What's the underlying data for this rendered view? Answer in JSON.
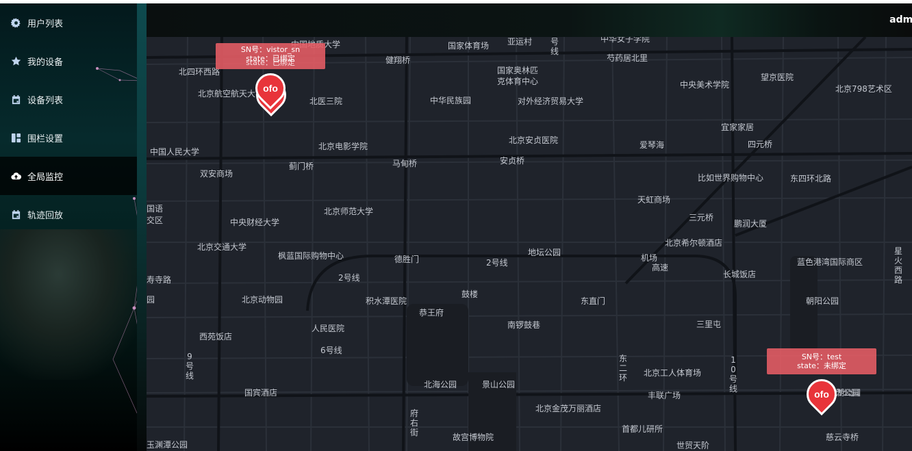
{
  "header": {
    "username": "admi"
  },
  "sidebar": {
    "items": [
      {
        "label": "用户列表",
        "icon": "gear-icon"
      },
      {
        "label": "我的设备",
        "icon": "star-icon"
      },
      {
        "label": "设备列表",
        "icon": "calendar-icon"
      },
      {
        "label": "围栏设置",
        "icon": "layout-icon"
      },
      {
        "label": "全局监控",
        "icon": "cloud-upload-icon",
        "active": true
      },
      {
        "label": "轨迹回放",
        "icon": "calendar-icon"
      }
    ]
  },
  "map": {
    "labels": [
      "中国地质大学",
      "国家体育场",
      "亚运村",
      "号",
      "线",
      "中华女子学院",
      "北四环西路",
      "健翔桥",
      "芍药居北里",
      "北京航空航天大学",
      "国家奥林匹",
      "克体育中心",
      "中央美术学院",
      "望京医院",
      "北京798艺术区",
      "北医三院",
      "中华民族园",
      "对外经济贸易大学",
      "宜家家居",
      "四元桥",
      "中国人民大学",
      "北京电影学院",
      "北京安贞医院",
      "爱琴海",
      "双安商场",
      "蓟门桥",
      "马甸桥",
      "安贞桥",
      "比如世界购物中心",
      "东四环北路",
      "天虹商场",
      "三元桥",
      "鹏润大厦",
      "国语",
      "交区",
      "中央财经大学",
      "北京师范大学",
      "北京希尔顿酒店",
      "北京交通大学",
      "枫蓝国际购物中心",
      "德胜门",
      "2号线",
      "地坛公园",
      "机场",
      "高速",
      "蓝色港湾国际商区",
      "星火西路",
      "长城饭店",
      "寿寺路",
      "北京动物园",
      "2号线",
      "积水潭医院",
      "鼓楼",
      "东直门",
      "朝阳公园",
      "园",
      "恭王府",
      "人民医院",
      "南锣鼓巷",
      "三里屯",
      "西苑饭店",
      "6号线",
      "9号线",
      "北京工人体育场",
      "东二环",
      "10号线",
      "北海公园",
      "景山公园",
      "国宾酒店",
      "丰联广场",
      "团结湖公园",
      "北京金茂万丽酒店",
      "府右街",
      "首都儿研所",
      "故宫博物院",
      "玉渊潭公园",
      "世贸天阶",
      "慈云寺桥",
      "领市公园"
    ],
    "markers": [
      {
        "sn_label": "SN号：vistor_sn",
        "state_label": "state：已绑定",
        "overlap_label": "state：已绑定",
        "logo": "ofo"
      },
      {
        "sn_label": "SN号：test",
        "state_label": "state：未绑定",
        "logo": "ofo"
      }
    ]
  },
  "colors": {
    "pin": "#e8343a",
    "infobox": "#e85d65",
    "map_bg": "#1f232b",
    "road": "#2b3039"
  }
}
